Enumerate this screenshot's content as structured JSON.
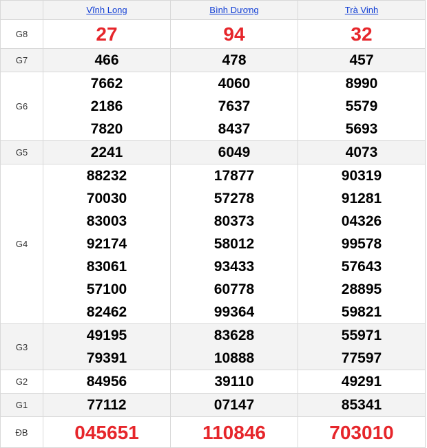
{
  "provinces": [
    "Vĩnh Long",
    "Bình Dương",
    "Trà Vinh"
  ],
  "prizes": [
    {
      "label": "G8",
      "numbers": [
        [
          "27"
        ],
        [
          "94"
        ],
        [
          "32"
        ]
      ]
    },
    {
      "label": "G7",
      "numbers": [
        [
          "466"
        ],
        [
          "478"
        ],
        [
          "457"
        ]
      ]
    },
    {
      "label": "G6",
      "numbers": [
        [
          "7662",
          "2186",
          "7820"
        ],
        [
          "4060",
          "7637",
          "8437"
        ],
        [
          "8990",
          "5579",
          "5693"
        ]
      ]
    },
    {
      "label": "G5",
      "numbers": [
        [
          "2241"
        ],
        [
          "6049"
        ],
        [
          "4073"
        ]
      ]
    },
    {
      "label": "G4",
      "numbers": [
        [
          "88232",
          "70030",
          "83003",
          "92174",
          "83061",
          "57100",
          "82462"
        ],
        [
          "17877",
          "57278",
          "80373",
          "58012",
          "93433",
          "60778",
          "99364"
        ],
        [
          "90319",
          "91281",
          "04326",
          "99578",
          "57643",
          "28895",
          "59821"
        ]
      ]
    },
    {
      "label": "G3",
      "numbers": [
        [
          "49195",
          "79391"
        ],
        [
          "83628",
          "10888"
        ],
        [
          "55971",
          "77597"
        ]
      ]
    },
    {
      "label": "G2",
      "numbers": [
        [
          "84956"
        ],
        [
          "39110"
        ],
        [
          "49291"
        ]
      ]
    },
    {
      "label": "G1",
      "numbers": [
        [
          "77112"
        ],
        [
          "07147"
        ],
        [
          "85341"
        ]
      ]
    },
    {
      "label": "ĐB",
      "numbers": [
        [
          "045651"
        ],
        [
          "110846"
        ],
        [
          "703010"
        ]
      ]
    }
  ],
  "colors": {
    "highlight": "#e6262b",
    "link": "#0d3bd4",
    "stripe": "#f3f3f3"
  }
}
